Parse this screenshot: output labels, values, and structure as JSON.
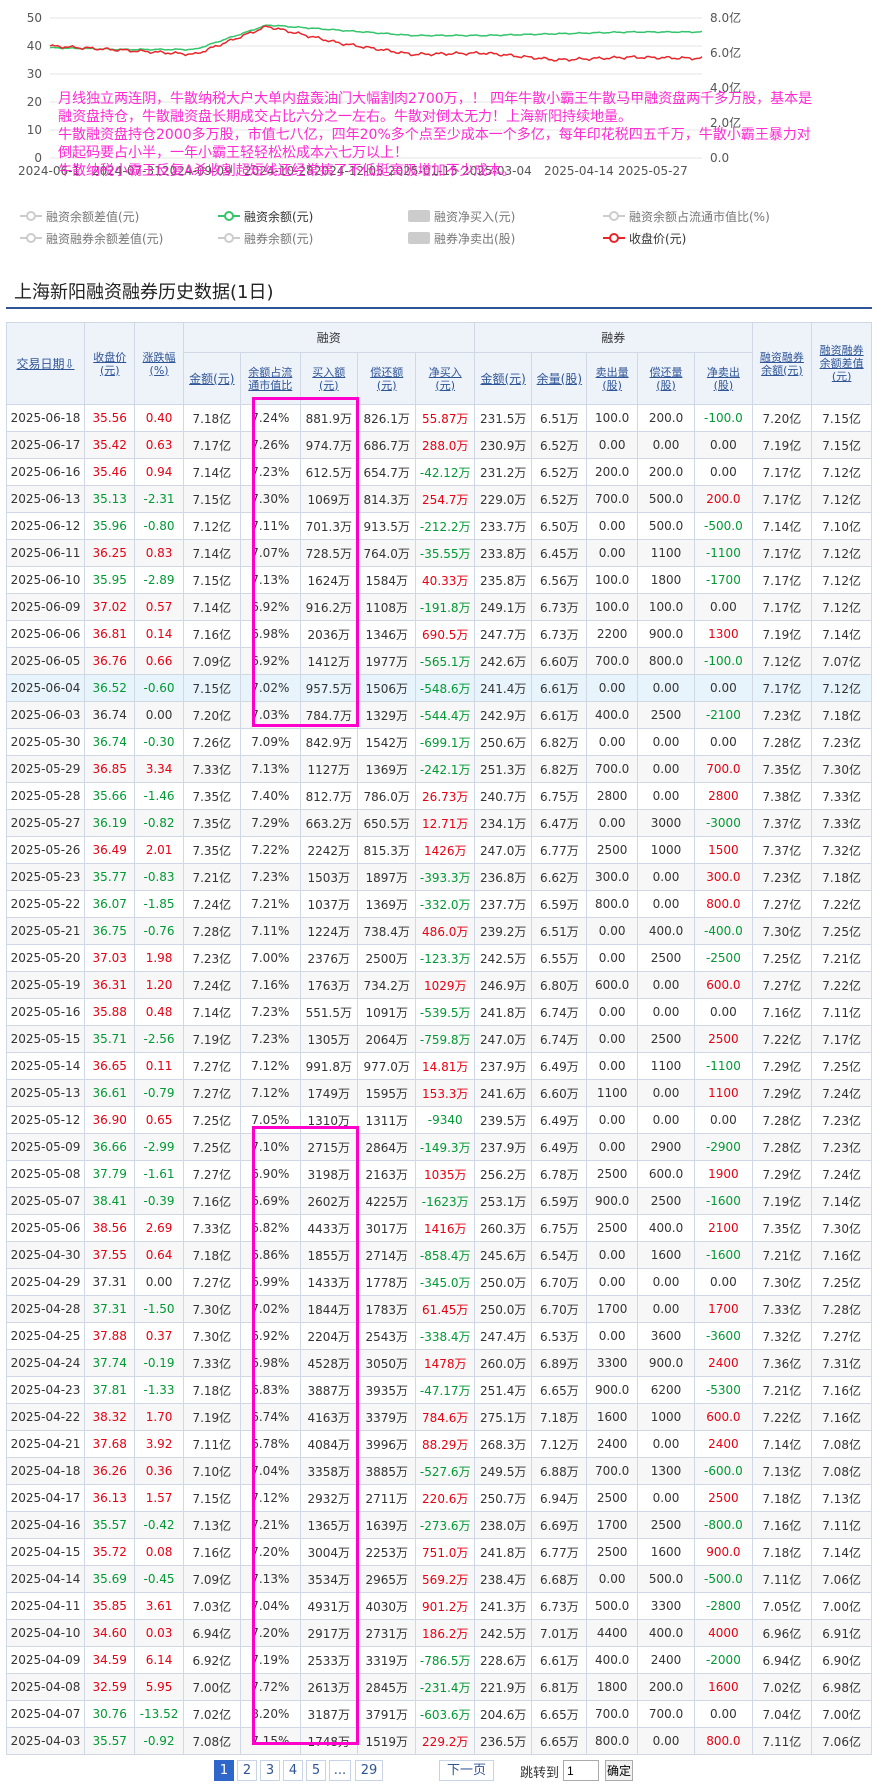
{
  "chart": {
    "left_axis_ticks": [
      "50",
      "40",
      "30",
      "20",
      "10",
      "0"
    ],
    "right_axis_ticks": [
      "8.0亿",
      "6.0亿",
      "4.0亿",
      "2.0亿",
      "0.0"
    ],
    "x_ticks": [
      "2024-06-1",
      "2024-07-31",
      "2024-09-09",
      "2024-10-28",
      "2024-12-05",
      "2025-01-15",
      "2025-03-04",
      "2025-04-14",
      "2025-05-27"
    ],
    "series_colors": {
      "financing_balance": "#35c46b",
      "close_price": "#e8262a"
    }
  },
  "chart_data": {
    "type": "line",
    "x": [
      "2024-06-18",
      "2024-07-31",
      "2024-09-09",
      "2024-10-28",
      "2024-12-05",
      "2025-01-15",
      "2025-03-04",
      "2025-04-14",
      "2025-05-27",
      "2025-06-18"
    ],
    "series": [
      {
        "name": "融资余额(元)",
        "values": [
          6.3,
          6.2,
          6.2,
          7.6,
          7.3,
          7.0,
          7.0,
          7.1,
          7.2,
          7.2
        ],
        "unit": "亿"
      },
      {
        "name": "收盘价(元)",
        "values": [
          40,
          38.5,
          37,
          47,
          41,
          37,
          37.5,
          35,
          36,
          35.56
        ]
      }
    ],
    "ylim_left": [
      0,
      50
    ],
    "ylim_right": [
      "0.0",
      "8.0亿"
    ],
    "legend_position": "bottom"
  },
  "overlay_text": [
    "月线独立两连阴，牛散纳税大户大单内盘轰油门大幅割肉2700万，！  四年牛散小霸王牛散马甲融资盘两千多万股，基本是融资盘持仓，牛散融资盘长期成交占比六分之一左右。牛散对倒太无力！上海新阳持续地量。",
    "牛散融资盘持仓2000多万股，市值七八亿，四年20%多个点至少成本一个多亿，每年印花税四五千万，牛散小霸王暴力对倒起码要占小半，一年小霸王轻轻松松成本六七万以上！",
    "牛散纳税小霸王反复A杀收割超短线还经常搞了不低挺高吸增加不少成本。"
  ],
  "legend": {
    "row1": [
      {
        "label": "融资余额差值(元)",
        "active": false,
        "style": "line-dot"
      },
      {
        "label": "融资余额(元)",
        "active": true,
        "style": "line-dot",
        "color": "#35c46b"
      },
      {
        "label": "融资净买入(元)",
        "active": false,
        "style": "box"
      },
      {
        "label": "融资余额占流通市值比(%)",
        "active": false,
        "style": "line-dot"
      }
    ],
    "row2": [
      {
        "label": "融资融券余额差值(元)",
        "active": false,
        "style": "line-dot"
      },
      {
        "label": "融券余额(元)",
        "active": false,
        "style": "line-dot"
      },
      {
        "label": "融券净卖出(股)",
        "active": false,
        "style": "box"
      },
      {
        "label": "收盘价(元)",
        "active": true,
        "style": "line-dot",
        "color": "#e8262a"
      }
    ]
  },
  "table_title": "上海新阳融资融券历史数据(1日)",
  "headers": {
    "date": "交易日期",
    "close": [
      "收盘价",
      "(元)"
    ],
    "change": [
      "涨跌幅",
      "(%)"
    ],
    "financing_group": "融资",
    "securities_group": "融券",
    "fin_balance": "金额(元)",
    "fin_ratio": [
      "余额占流",
      "通市值比"
    ],
    "fin_buy": [
      "买入额",
      "(元)"
    ],
    "fin_repay": [
      "偿还额",
      "(元)"
    ],
    "fin_net": [
      "净买入",
      "(元)"
    ],
    "sec_balance": "金额(元)",
    "sec_volume": "余量(股)",
    "sec_sell": [
      "卖出量",
      "(股)"
    ],
    "sec_repay": [
      "偿还量",
      "(股)"
    ],
    "sec_net": [
      "净卖出",
      "(股)"
    ],
    "total_balance": [
      "融资融券",
      "余额(元)"
    ],
    "diff": [
      "融资融券",
      "余额差值",
      "(元)"
    ]
  },
  "rows": [
    [
      "2025-06-18",
      "35.56",
      "0.40",
      "7.18亿",
      "7.24%",
      "881.9万",
      "826.1万",
      "55.87万",
      "231.5万",
      "6.51万",
      "100.0",
      "200.0",
      "-100.0",
      "7.20亿",
      "7.15亿"
    ],
    [
      "2025-06-17",
      "35.42",
      "0.63",
      "7.17亿",
      "7.26%",
      "974.7万",
      "686.7万",
      "288.0万",
      "230.9万",
      "6.52万",
      "0.00",
      "0.00",
      "0.00",
      "7.19亿",
      "7.15亿"
    ],
    [
      "2025-06-16",
      "35.46",
      "0.94",
      "7.14亿",
      "7.23%",
      "612.5万",
      "654.7万",
      "-42.12万",
      "231.2万",
      "6.52万",
      "200.0",
      "200.0",
      "0.00",
      "7.17亿",
      "7.12亿"
    ],
    [
      "2025-06-13",
      "35.13",
      "-2.31",
      "7.15亿",
      "7.30%",
      "1069万",
      "814.3万",
      "254.7万",
      "229.0万",
      "6.52万",
      "700.0",
      "500.0",
      "200.0",
      "7.17亿",
      "7.12亿"
    ],
    [
      "2025-06-12",
      "35.96",
      "-0.80",
      "7.12亿",
      "7.11%",
      "701.3万",
      "913.5万",
      "-212.2万",
      "233.7万",
      "6.50万",
      "0.00",
      "500.0",
      "-500.0",
      "7.14亿",
      "7.10亿"
    ],
    [
      "2025-06-11",
      "36.25",
      "0.83",
      "7.14亿",
      "7.07%",
      "728.5万",
      "764.0万",
      "-35.55万",
      "233.8万",
      "6.45万",
      "0.00",
      "1100",
      "-1100",
      "7.17亿",
      "7.12亿"
    ],
    [
      "2025-06-10",
      "35.95",
      "-2.89",
      "7.15亿",
      "7.13%",
      "1624万",
      "1584万",
      "40.33万",
      "235.8万",
      "6.56万",
      "100.0",
      "1800",
      "-1700",
      "7.17亿",
      "7.12亿"
    ],
    [
      "2025-06-09",
      "37.02",
      "0.57",
      "7.14亿",
      "6.92%",
      "916.2万",
      "1108万",
      "-191.8万",
      "249.1万",
      "6.73万",
      "100.0",
      "100.0",
      "0.00",
      "7.17亿",
      "7.12亿"
    ],
    [
      "2025-06-06",
      "36.81",
      "0.14",
      "7.16亿",
      "6.98%",
      "2036万",
      "1346万",
      "690.5万",
      "247.7万",
      "6.73万",
      "2200",
      "900.0",
      "1300",
      "7.19亿",
      "7.14亿"
    ],
    [
      "2025-06-05",
      "36.76",
      "0.66",
      "7.09亿",
      "6.92%",
      "1412万",
      "1977万",
      "-565.1万",
      "242.6万",
      "6.60万",
      "700.0",
      "800.0",
      "-100.0",
      "7.12亿",
      "7.07亿"
    ],
    [
      "2025-06-04",
      "36.52",
      "-0.60",
      "7.15亿",
      "7.02%",
      "957.5万",
      "1506万",
      "-548.6万",
      "241.4万",
      "6.61万",
      "0.00",
      "0.00",
      "0.00",
      "7.17亿",
      "7.12亿"
    ],
    [
      "2025-06-03",
      "36.74",
      "0.00",
      "7.20亿",
      "7.03%",
      "784.7万",
      "1329万",
      "-544.4万",
      "242.9万",
      "6.61万",
      "400.0",
      "2500",
      "-2100",
      "7.23亿",
      "7.18亿"
    ],
    [
      "2025-05-30",
      "36.74",
      "-0.30",
      "7.26亿",
      "7.09%",
      "842.9万",
      "1542万",
      "-699.1万",
      "250.6万",
      "6.82万",
      "0.00",
      "0.00",
      "0.00",
      "7.28亿",
      "7.23亿"
    ],
    [
      "2025-05-29",
      "36.85",
      "3.34",
      "7.33亿",
      "7.13%",
      "1127万",
      "1369万",
      "-242.1万",
      "251.3万",
      "6.82万",
      "700.0",
      "0.00",
      "700.0",
      "7.35亿",
      "7.30亿"
    ],
    [
      "2025-05-28",
      "35.66",
      "-1.46",
      "7.35亿",
      "7.40%",
      "812.7万",
      "786.0万",
      "26.73万",
      "240.7万",
      "6.75万",
      "2800",
      "0.00",
      "2800",
      "7.38亿",
      "7.33亿"
    ],
    [
      "2025-05-27",
      "36.19",
      "-0.82",
      "7.35亿",
      "7.29%",
      "663.2万",
      "650.5万",
      "12.71万",
      "234.1万",
      "6.47万",
      "0.00",
      "3000",
      "-3000",
      "7.37亿",
      "7.33亿"
    ],
    [
      "2025-05-26",
      "36.49",
      "2.01",
      "7.35亿",
      "7.22%",
      "2242万",
      "815.3万",
      "1426万",
      "247.0万",
      "6.77万",
      "2500",
      "1000",
      "1500",
      "7.37亿",
      "7.32亿"
    ],
    [
      "2025-05-23",
      "35.77",
      "-0.83",
      "7.21亿",
      "7.23%",
      "1503万",
      "1897万",
      "-393.3万",
      "236.8万",
      "6.62万",
      "300.0",
      "0.00",
      "300.0",
      "7.23亿",
      "7.18亿"
    ],
    [
      "2025-05-22",
      "36.07",
      "-1.85",
      "7.24亿",
      "7.21%",
      "1037万",
      "1369万",
      "-332.0万",
      "237.7万",
      "6.59万",
      "800.0",
      "0.00",
      "800.0",
      "7.27亿",
      "7.22亿"
    ],
    [
      "2025-05-21",
      "36.75",
      "-0.76",
      "7.28亿",
      "7.11%",
      "1224万",
      "738.4万",
      "486.0万",
      "239.2万",
      "6.51万",
      "0.00",
      "400.0",
      "-400.0",
      "7.30亿",
      "7.25亿"
    ],
    [
      "2025-05-20",
      "37.03",
      "1.98",
      "7.23亿",
      "7.00%",
      "2376万",
      "2500万",
      "-123.3万",
      "242.5万",
      "6.55万",
      "0.00",
      "2500",
      "-2500",
      "7.25亿",
      "7.21亿"
    ],
    [
      "2025-05-19",
      "36.31",
      "1.20",
      "7.24亿",
      "7.16%",
      "1763万",
      "734.2万",
      "1029万",
      "246.9万",
      "6.80万",
      "600.0",
      "0.00",
      "600.0",
      "7.27亿",
      "7.22亿"
    ],
    [
      "2025-05-16",
      "35.88",
      "0.48",
      "7.14亿",
      "7.23%",
      "551.5万",
      "1091万",
      "-539.5万",
      "241.8万",
      "6.74万",
      "0.00",
      "0.00",
      "0.00",
      "7.16亿",
      "7.11亿"
    ],
    [
      "2025-05-15",
      "35.71",
      "-2.56",
      "7.19亿",
      "7.23%",
      "1305万",
      "2064万",
      "-759.8万",
      "247.0万",
      "6.74万",
      "0.00",
      "2500",
      "2500",
      "7.22亿",
      "7.17亿"
    ],
    [
      "2025-05-14",
      "36.65",
      "0.11",
      "7.27亿",
      "7.12%",
      "991.8万",
      "977.0万",
      "14.81万",
      "237.9万",
      "6.49万",
      "0.00",
      "1100",
      "-1100",
      "7.29亿",
      "7.25亿"
    ],
    [
      "2025-05-13",
      "36.61",
      "-0.79",
      "7.27亿",
      "7.12%",
      "1749万",
      "1595万",
      "153.3万",
      "241.6万",
      "6.60万",
      "1100",
      "0.00",
      "1100",
      "7.29亿",
      "7.24亿"
    ],
    [
      "2025-05-12",
      "36.90",
      "0.65",
      "7.25亿",
      "7.05%",
      "1310万",
      "1311万",
      "-9340",
      "239.5万",
      "6.49万",
      "0.00",
      "0.00",
      "0.00",
      "7.28亿",
      "7.23亿"
    ],
    [
      "2025-05-09",
      "36.66",
      "-2.99",
      "7.25亿",
      "7.10%",
      "2715万",
      "2864万",
      "-149.3万",
      "237.9万",
      "6.49万",
      "0.00",
      "2900",
      "-2900",
      "7.28亿",
      "7.23亿"
    ],
    [
      "2025-05-08",
      "37.79",
      "-1.61",
      "7.27亿",
      "6.90%",
      "3198万",
      "2163万",
      "1035万",
      "256.2万",
      "6.78万",
      "2500",
      "600.0",
      "1900",
      "7.29亿",
      "7.24亿"
    ],
    [
      "2025-05-07",
      "38.41",
      "-0.39",
      "7.16亿",
      "6.69%",
      "2602万",
      "4225万",
      "-1623万",
      "253.1万",
      "6.59万",
      "900.0",
      "2500",
      "-1600",
      "7.19亿",
      "7.14亿"
    ],
    [
      "2025-05-06",
      "38.56",
      "2.69",
      "7.33亿",
      "6.82%",
      "4433万",
      "3017万",
      "1416万",
      "260.3万",
      "6.75万",
      "2500",
      "400.0",
      "2100",
      "7.35亿",
      "7.30亿"
    ],
    [
      "2025-04-30",
      "37.55",
      "0.64",
      "7.18亿",
      "6.86%",
      "1855万",
      "2714万",
      "-858.4万",
      "245.6万",
      "6.54万",
      "0.00",
      "1600",
      "-1600",
      "7.21亿",
      "7.16亿"
    ],
    [
      "2025-04-29",
      "37.31",
      "0.00",
      "7.27亿",
      "6.99%",
      "1433万",
      "1778万",
      "-345.0万",
      "250.0万",
      "6.70万",
      "0.00",
      "0.00",
      "0.00",
      "7.30亿",
      "7.25亿"
    ],
    [
      "2025-04-28",
      "37.31",
      "-1.50",
      "7.30亿",
      "7.02%",
      "1844万",
      "1783万",
      "61.45万",
      "250.0万",
      "6.70万",
      "1700",
      "0.00",
      "1700",
      "7.33亿",
      "7.28亿"
    ],
    [
      "2025-04-25",
      "37.88",
      "0.37",
      "7.30亿",
      "6.92%",
      "2204万",
      "2543万",
      "-338.4万",
      "247.4万",
      "6.53万",
      "0.00",
      "3600",
      "-3600",
      "7.32亿",
      "7.27亿"
    ],
    [
      "2025-04-24",
      "37.74",
      "-0.19",
      "7.33亿",
      "6.98%",
      "4528万",
      "3050万",
      "1478万",
      "260.0万",
      "6.89万",
      "3300",
      "900.0",
      "2400",
      "7.36亿",
      "7.31亿"
    ],
    [
      "2025-04-23",
      "37.81",
      "-1.33",
      "7.18亿",
      "6.83%",
      "3887万",
      "3935万",
      "-47.17万",
      "251.4万",
      "6.65万",
      "900.0",
      "6200",
      "-5300",
      "7.21亿",
      "7.16亿"
    ],
    [
      "2025-04-22",
      "38.32",
      "1.70",
      "7.19亿",
      "6.74%",
      "4163万",
      "3379万",
      "784.6万",
      "275.1万",
      "7.18万",
      "1600",
      "1000",
      "600.0",
      "7.22亿",
      "7.16亿"
    ],
    [
      "2025-04-21",
      "37.68",
      "3.92",
      "7.11亿",
      "6.78%",
      "4084万",
      "3996万",
      "88.29万",
      "268.3万",
      "7.12万",
      "2400",
      "0.00",
      "2400",
      "7.14亿",
      "7.08亿"
    ],
    [
      "2025-04-18",
      "36.26",
      "0.36",
      "7.10亿",
      "7.04%",
      "3358万",
      "3885万",
      "-527.6万",
      "249.5万",
      "6.88万",
      "700.0",
      "1300",
      "-600.0",
      "7.13亿",
      "7.08亿"
    ],
    [
      "2025-04-17",
      "36.13",
      "1.57",
      "7.15亿",
      "7.12%",
      "2932万",
      "2711万",
      "220.6万",
      "250.7万",
      "6.94万",
      "2500",
      "0.00",
      "2500",
      "7.18亿",
      "7.13亿"
    ],
    [
      "2025-04-16",
      "35.57",
      "-0.42",
      "7.13亿",
      "7.21%",
      "1365万",
      "1639万",
      "-273.6万",
      "238.0万",
      "6.69万",
      "1700",
      "2500",
      "-800.0",
      "7.16亿",
      "7.11亿"
    ],
    [
      "2025-04-15",
      "35.72",
      "0.08",
      "7.16亿",
      "7.20%",
      "3004万",
      "2253万",
      "751.0万",
      "241.8万",
      "6.77万",
      "2500",
      "1600",
      "900.0",
      "7.18亿",
      "7.14亿"
    ],
    [
      "2025-04-14",
      "35.69",
      "-0.45",
      "7.09亿",
      "7.13%",
      "3534万",
      "2965万",
      "569.2万",
      "238.4万",
      "6.68万",
      "0.00",
      "500.0",
      "-500.0",
      "7.11亿",
      "7.06亿"
    ],
    [
      "2025-04-11",
      "35.85",
      "3.61",
      "7.03亿",
      "7.04%",
      "4931万",
      "4030万",
      "901.2万",
      "241.3万",
      "6.73万",
      "500.0",
      "3300",
      "-2800",
      "7.05亿",
      "7.00亿"
    ],
    [
      "2025-04-10",
      "34.60",
      "0.03",
      "6.94亿",
      "7.20%",
      "2917万",
      "2731万",
      "186.2万",
      "242.5万",
      "7.01万",
      "4400",
      "400.0",
      "4000",
      "6.96亿",
      "6.91亿"
    ],
    [
      "2025-04-09",
      "34.59",
      "6.14",
      "6.92亿",
      "7.19%",
      "2533万",
      "3319万",
      "-786.5万",
      "228.6万",
      "6.61万",
      "400.0",
      "2400",
      "-2000",
      "6.94亿",
      "6.90亿"
    ],
    [
      "2025-04-08",
      "32.59",
      "5.95",
      "7.00亿",
      "7.72%",
      "2613万",
      "2845万",
      "-231.4万",
      "221.9万",
      "6.81万",
      "1800",
      "200.0",
      "1600",
      "7.02亿",
      "6.98亿"
    ],
    [
      "2025-04-07",
      "30.76",
      "-13.52",
      "7.02亿",
      "8.20%",
      "3187万",
      "3791万",
      "-603.6万",
      "204.6万",
      "6.65万",
      "700.0",
      "700.0",
      "0.00",
      "7.04亿",
      "7.00亿"
    ],
    [
      "2025-04-03",
      "35.57",
      "-0.92",
      "7.08亿",
      "7.15%",
      "1748万",
      "1519万",
      "229.2万",
      "236.5万",
      "6.65万",
      "800.0",
      "0.00",
      "800.0",
      "7.11亿",
      "7.06亿"
    ]
  ],
  "highlighted_row": 10,
  "pager": {
    "pages": [
      "1",
      "2",
      "3",
      "4",
      "5",
      "...",
      "29"
    ],
    "active": "1",
    "next": "下一页",
    "jump_label": "跳转到",
    "jump_value": "1",
    "confirm": "确定"
  }
}
